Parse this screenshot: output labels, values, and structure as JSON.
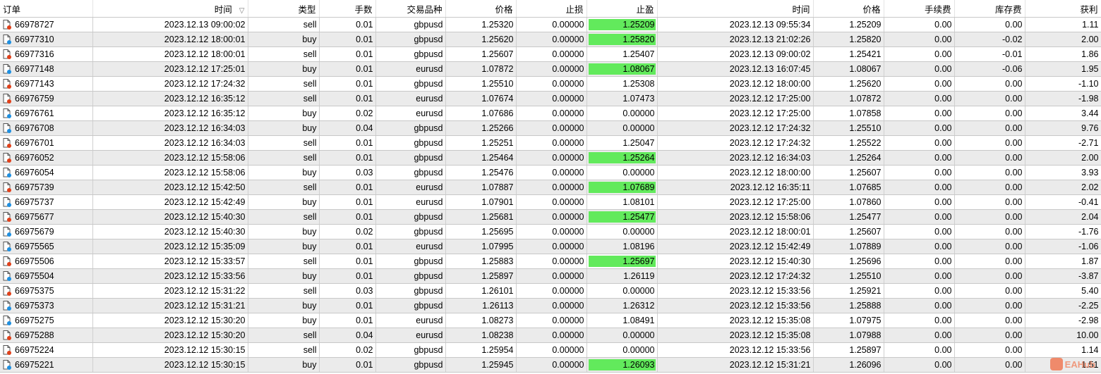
{
  "headers": [
    "订单",
    "时间",
    "类型",
    "手数",
    "交易品种",
    "价格",
    "止损",
    "止盈",
    "时间",
    "价格",
    "手续费",
    "库存费",
    "获利"
  ],
  "sort_indicator": "▽",
  "colors": {
    "tp_hit": "#62ea5c",
    "sell_icon": "#e0401a",
    "buy_icon": "#1e8fe0",
    "alt_row": "#ebebeb"
  },
  "watermark": "EAHub",
  "rows": [
    {
      "order": "66978727",
      "open_time": "2023.12.13 09:00:02",
      "type": "sell",
      "lots": "0.01",
      "symbol": "gbpusd",
      "price": "1.25320",
      "sl": "0.00000",
      "tp": "1.25209",
      "tp_hit": true,
      "close_time": "2023.12.13 09:55:34",
      "close_price": "1.25209",
      "commission": "0.00",
      "swap": "0.00",
      "profit": "1.11"
    },
    {
      "order": "66977310",
      "open_time": "2023.12.12 18:00:01",
      "type": "buy",
      "lots": "0.01",
      "symbol": "gbpusd",
      "price": "1.25620",
      "sl": "0.00000",
      "tp": "1.25820",
      "tp_hit": true,
      "close_time": "2023.12.13 21:02:26",
      "close_price": "1.25820",
      "commission": "0.00",
      "swap": "-0.02",
      "profit": "2.00"
    },
    {
      "order": "66977316",
      "open_time": "2023.12.12 18:00:01",
      "type": "sell",
      "lots": "0.01",
      "symbol": "gbpusd",
      "price": "1.25607",
      "sl": "0.00000",
      "tp": "1.25407",
      "tp_hit": false,
      "close_time": "2023.12.13 09:00:02",
      "close_price": "1.25421",
      "commission": "0.00",
      "swap": "-0.01",
      "profit": "1.86"
    },
    {
      "order": "66977148",
      "open_time": "2023.12.12 17:25:01",
      "type": "buy",
      "lots": "0.01",
      "symbol": "eurusd",
      "price": "1.07872",
      "sl": "0.00000",
      "tp": "1.08067",
      "tp_hit": true,
      "close_time": "2023.12.13 16:07:45",
      "close_price": "1.08067",
      "commission": "0.00",
      "swap": "-0.06",
      "profit": "1.95"
    },
    {
      "order": "66977143",
      "open_time": "2023.12.12 17:24:32",
      "type": "sell",
      "lots": "0.01",
      "symbol": "gbpusd",
      "price": "1.25510",
      "sl": "0.00000",
      "tp": "1.25308",
      "tp_hit": false,
      "close_time": "2023.12.12 18:00:00",
      "close_price": "1.25620",
      "commission": "0.00",
      "swap": "0.00",
      "profit": "-1.10"
    },
    {
      "order": "66976759",
      "open_time": "2023.12.12 16:35:12",
      "type": "sell",
      "lots": "0.01",
      "symbol": "eurusd",
      "price": "1.07674",
      "sl": "0.00000",
      "tp": "1.07473",
      "tp_hit": false,
      "close_time": "2023.12.12 17:25:00",
      "close_price": "1.07872",
      "commission": "0.00",
      "swap": "0.00",
      "profit": "-1.98"
    },
    {
      "order": "66976761",
      "open_time": "2023.12.12 16:35:12",
      "type": "buy",
      "lots": "0.02",
      "symbol": "eurusd",
      "price": "1.07686",
      "sl": "0.00000",
      "tp": "0.00000",
      "tp_hit": false,
      "close_time": "2023.12.12 17:25:00",
      "close_price": "1.07858",
      "commission": "0.00",
      "swap": "0.00",
      "profit": "3.44"
    },
    {
      "order": "66976708",
      "open_time": "2023.12.12 16:34:03",
      "type": "buy",
      "lots": "0.04",
      "symbol": "gbpusd",
      "price": "1.25266",
      "sl": "0.00000",
      "tp": "0.00000",
      "tp_hit": false,
      "close_time": "2023.12.12 17:24:32",
      "close_price": "1.25510",
      "commission": "0.00",
      "swap": "0.00",
      "profit": "9.76"
    },
    {
      "order": "66976701",
      "open_time": "2023.12.12 16:34:03",
      "type": "sell",
      "lots": "0.01",
      "symbol": "gbpusd",
      "price": "1.25251",
      "sl": "0.00000",
      "tp": "1.25047",
      "tp_hit": false,
      "close_time": "2023.12.12 17:24:32",
      "close_price": "1.25522",
      "commission": "0.00",
      "swap": "0.00",
      "profit": "-2.71"
    },
    {
      "order": "66976052",
      "open_time": "2023.12.12 15:58:06",
      "type": "sell",
      "lots": "0.01",
      "symbol": "gbpusd",
      "price": "1.25464",
      "sl": "0.00000",
      "tp": "1.25264",
      "tp_hit": true,
      "close_time": "2023.12.12 16:34:03",
      "close_price": "1.25264",
      "commission": "0.00",
      "swap": "0.00",
      "profit": "2.00"
    },
    {
      "order": "66976054",
      "open_time": "2023.12.12 15:58:06",
      "type": "buy",
      "lots": "0.03",
      "symbol": "gbpusd",
      "price": "1.25476",
      "sl": "0.00000",
      "tp": "0.00000",
      "tp_hit": false,
      "close_time": "2023.12.12 18:00:00",
      "close_price": "1.25607",
      "commission": "0.00",
      "swap": "0.00",
      "profit": "3.93"
    },
    {
      "order": "66975739",
      "open_time": "2023.12.12 15:42:50",
      "type": "sell",
      "lots": "0.01",
      "symbol": "eurusd",
      "price": "1.07887",
      "sl": "0.00000",
      "tp": "1.07689",
      "tp_hit": true,
      "close_time": "2023.12.12 16:35:11",
      "close_price": "1.07685",
      "commission": "0.00",
      "swap": "0.00",
      "profit": "2.02"
    },
    {
      "order": "66975737",
      "open_time": "2023.12.12 15:42:49",
      "type": "buy",
      "lots": "0.01",
      "symbol": "eurusd",
      "price": "1.07901",
      "sl": "0.00000",
      "tp": "1.08101",
      "tp_hit": false,
      "close_time": "2023.12.12 17:25:00",
      "close_price": "1.07860",
      "commission": "0.00",
      "swap": "0.00",
      "profit": "-0.41"
    },
    {
      "order": "66975677",
      "open_time": "2023.12.12 15:40:30",
      "type": "sell",
      "lots": "0.01",
      "symbol": "gbpusd",
      "price": "1.25681",
      "sl": "0.00000",
      "tp": "1.25477",
      "tp_hit": true,
      "close_time": "2023.12.12 15:58:06",
      "close_price": "1.25477",
      "commission": "0.00",
      "swap": "0.00",
      "profit": "2.04"
    },
    {
      "order": "66975679",
      "open_time": "2023.12.12 15:40:30",
      "type": "buy",
      "lots": "0.02",
      "symbol": "gbpusd",
      "price": "1.25695",
      "sl": "0.00000",
      "tp": "0.00000",
      "tp_hit": false,
      "close_time": "2023.12.12 18:00:01",
      "close_price": "1.25607",
      "commission": "0.00",
      "swap": "0.00",
      "profit": "-1.76"
    },
    {
      "order": "66975565",
      "open_time": "2023.12.12 15:35:09",
      "type": "buy",
      "lots": "0.01",
      "symbol": "eurusd",
      "price": "1.07995",
      "sl": "0.00000",
      "tp": "1.08196",
      "tp_hit": false,
      "close_time": "2023.12.12 15:42:49",
      "close_price": "1.07889",
      "commission": "0.00",
      "swap": "0.00",
      "profit": "-1.06"
    },
    {
      "order": "66975506",
      "open_time": "2023.12.12 15:33:57",
      "type": "sell",
      "lots": "0.01",
      "symbol": "gbpusd",
      "price": "1.25883",
      "sl": "0.00000",
      "tp": "1.25697",
      "tp_hit": true,
      "close_time": "2023.12.12 15:40:30",
      "close_price": "1.25696",
      "commission": "0.00",
      "swap": "0.00",
      "profit": "1.87"
    },
    {
      "order": "66975504",
      "open_time": "2023.12.12 15:33:56",
      "type": "buy",
      "lots": "0.01",
      "symbol": "gbpusd",
      "price": "1.25897",
      "sl": "0.00000",
      "tp": "1.26119",
      "tp_hit": false,
      "close_time": "2023.12.12 17:24:32",
      "close_price": "1.25510",
      "commission": "0.00",
      "swap": "0.00",
      "profit": "-3.87"
    },
    {
      "order": "66975375",
      "open_time": "2023.12.12 15:31:22",
      "type": "sell",
      "lots": "0.03",
      "symbol": "gbpusd",
      "price": "1.26101",
      "sl": "0.00000",
      "tp": "0.00000",
      "tp_hit": false,
      "close_time": "2023.12.12 15:33:56",
      "close_price": "1.25921",
      "commission": "0.00",
      "swap": "0.00",
      "profit": "5.40"
    },
    {
      "order": "66975373",
      "open_time": "2023.12.12 15:31:21",
      "type": "buy",
      "lots": "0.01",
      "symbol": "gbpusd",
      "price": "1.26113",
      "sl": "0.00000",
      "tp": "1.26312",
      "tp_hit": false,
      "close_time": "2023.12.12 15:33:56",
      "close_price": "1.25888",
      "commission": "0.00",
      "swap": "0.00",
      "profit": "-2.25"
    },
    {
      "order": "66975275",
      "open_time": "2023.12.12 15:30:20",
      "type": "buy",
      "lots": "0.01",
      "symbol": "eurusd",
      "price": "1.08273",
      "sl": "0.00000",
      "tp": "1.08491",
      "tp_hit": false,
      "close_time": "2023.12.12 15:35:08",
      "close_price": "1.07975",
      "commission": "0.00",
      "swap": "0.00",
      "profit": "-2.98"
    },
    {
      "order": "66975288",
      "open_time": "2023.12.12 15:30:20",
      "type": "sell",
      "lots": "0.04",
      "symbol": "eurusd",
      "price": "1.08238",
      "sl": "0.00000",
      "tp": "0.00000",
      "tp_hit": false,
      "close_time": "2023.12.12 15:35:08",
      "close_price": "1.07988",
      "commission": "0.00",
      "swap": "0.00",
      "profit": "10.00"
    },
    {
      "order": "66975224",
      "open_time": "2023.12.12 15:30:15",
      "type": "sell",
      "lots": "0.02",
      "symbol": "gbpusd",
      "price": "1.25954",
      "sl": "0.00000",
      "tp": "0.00000",
      "tp_hit": false,
      "close_time": "2023.12.12 15:33:56",
      "close_price": "1.25897",
      "commission": "0.00",
      "swap": "0.00",
      "profit": "1.14"
    },
    {
      "order": "66975221",
      "open_time": "2023.12.12 15:30:15",
      "type": "buy",
      "lots": "0.01",
      "symbol": "gbpusd",
      "price": "1.25945",
      "sl": "0.00000",
      "tp": "1.26093",
      "tp_hit": true,
      "close_time": "2023.12.12 15:31:21",
      "close_price": "1.26096",
      "commission": "0.00",
      "swap": "0.00",
      "profit": "1.51"
    }
  ]
}
